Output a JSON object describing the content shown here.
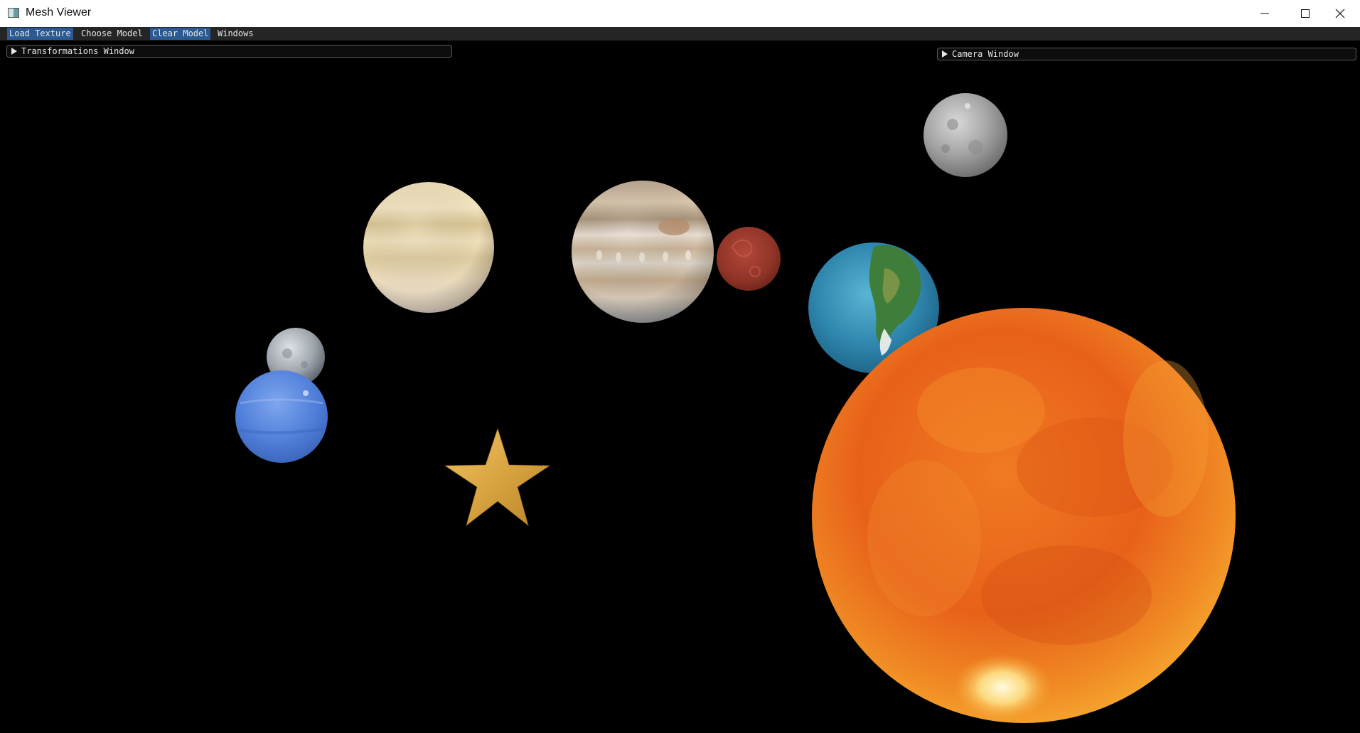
{
  "window": {
    "title": "Mesh Viewer",
    "icon": "app-window-icon",
    "controls": [
      "minimize-icon",
      "maximize-icon",
      "close-icon"
    ]
  },
  "menubar": {
    "items": [
      {
        "label": "Load Texture",
        "active": true
      },
      {
        "label": "Choose Model",
        "active": false
      },
      {
        "label": "Clear Model",
        "active": true
      },
      {
        "label": "Windows",
        "active": false
      }
    ]
  },
  "panels": {
    "transformations": {
      "label": "Transformations Window",
      "collapsed": true
    },
    "camera": {
      "label": "Camera Window",
      "collapsed": true
    }
  },
  "scene": {
    "background": "#000000",
    "objects": [
      {
        "name": "moon-sphere",
        "texture": "moon",
        "color": "#9a9a9a"
      },
      {
        "name": "saturn-sphere",
        "texture": "saturn",
        "color": "#e8d5a8"
      },
      {
        "name": "jupiter-sphere",
        "texture": "jupiter",
        "color": "#c7b39a"
      },
      {
        "name": "mars-sphere",
        "texture": "mars",
        "color": "#9b3a2a"
      },
      {
        "name": "earth-sphere",
        "texture": "earth",
        "color": "#2f86ad"
      },
      {
        "name": "mercury-sphere",
        "texture": "mercury",
        "color": "#9ea4ab"
      },
      {
        "name": "neptune-sphere",
        "texture": "neptune",
        "color": "#4f7fd9"
      },
      {
        "name": "star-model",
        "texture": "gold",
        "color": "#d9a441"
      },
      {
        "name": "sun-sphere",
        "texture": "sun",
        "color": "#e8611a"
      }
    ]
  }
}
